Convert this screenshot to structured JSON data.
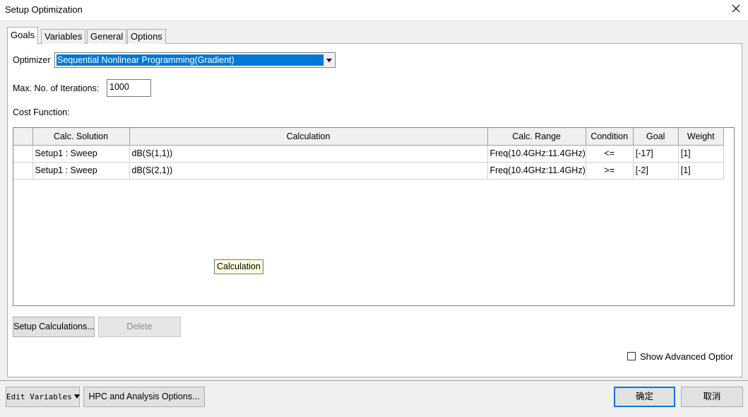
{
  "window": {
    "title": "Setup Optimization"
  },
  "tabs": [
    {
      "label": "Goals",
      "active": true
    },
    {
      "label": "Variables",
      "active": false
    },
    {
      "label": "General",
      "active": false
    },
    {
      "label": "Options",
      "active": false
    }
  ],
  "optimizer": {
    "label": "Optimizer",
    "value": "Sequential Nonlinear Programming(Gradient)"
  },
  "iterations": {
    "label": "Max. No. of Iterations:",
    "value": "1000"
  },
  "cost_function": {
    "label": "Cost Function:",
    "columns": [
      "",
      "Calc. Solution",
      "Calculation",
      "Calc. Range",
      "Condition",
      "Goal",
      "Weight"
    ],
    "rows": [
      [
        "",
        "Setup1 : Sweep",
        "dB(S(1,1))",
        "Freq(10.4GHz:11.4GHz)",
        "<=",
        "[-17]",
        "[1]"
      ],
      [
        "",
        "Setup1 : Sweep",
        "dB(S(2,1))",
        "Freq(10.4GHz:11.4GHz)",
        ">=",
        "[-2]",
        "[1]"
      ]
    ]
  },
  "tooltip": "Calculation",
  "buttons": {
    "setup_calculations": "Setup Calculations...",
    "delete": "Delete",
    "edit_variables": "Edit Variables",
    "hpc_options": "HPC and Analysis Options...",
    "ok": "确定",
    "cancel": "取消"
  },
  "show_advanced": {
    "label": "Show Advanced Optior",
    "checked": false
  },
  "icons": {
    "close": "close-icon",
    "dropdown": "chevron-down-icon"
  }
}
